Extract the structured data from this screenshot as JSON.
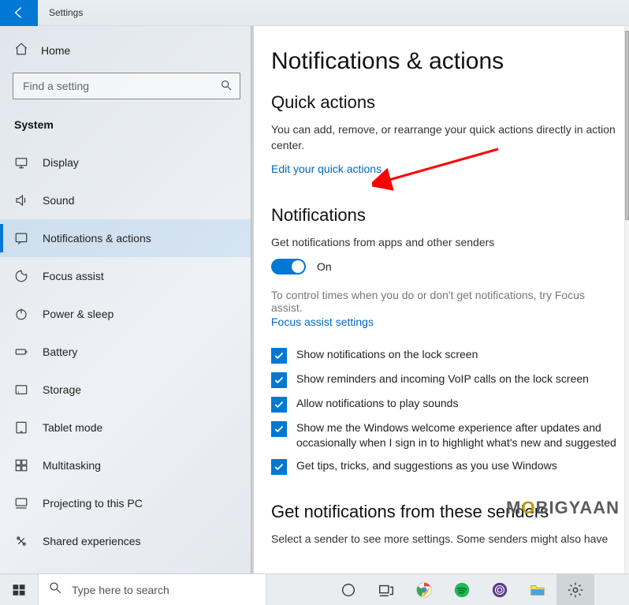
{
  "titlebar": {
    "title": "Settings"
  },
  "sidebar": {
    "home_label": "Home",
    "search_placeholder": "Find a setting",
    "section_head": "System",
    "items": [
      {
        "label": "Display"
      },
      {
        "label": "Sound"
      },
      {
        "label": "Notifications & actions"
      },
      {
        "label": "Focus assist"
      },
      {
        "label": "Power & sleep"
      },
      {
        "label": "Battery"
      },
      {
        "label": "Storage"
      },
      {
        "label": "Tablet mode"
      },
      {
        "label": "Multitasking"
      },
      {
        "label": "Projecting to this PC"
      },
      {
        "label": "Shared experiences"
      }
    ],
    "active_index": 2
  },
  "content": {
    "page_title": "Notifications & actions",
    "quick_actions": {
      "heading": "Quick actions",
      "description": "You can add, remove, or rearrange your quick actions directly in action center.",
      "link": "Edit your quick actions"
    },
    "notifications": {
      "heading": "Notifications",
      "master_label": "Get notifications from apps and other senders",
      "master_state_text": "On",
      "focus_hint": "To control times when you do or don't get notifications, try Focus assist.",
      "focus_link": "Focus assist settings",
      "checkboxes": [
        "Show notifications on the lock screen",
        "Show reminders and incoming VoIP calls on the lock screen",
        "Allow notifications to play sounds",
        "Show me the Windows welcome experience after updates and occasionally when I sign in to highlight what's new and suggested",
        "Get tips, tricks, and suggestions as you use Windows"
      ]
    },
    "senders": {
      "heading": "Get notifications from these senders",
      "description": "Select a sender to see more settings. Some senders might also have"
    }
  },
  "watermark": {
    "part1": "M",
    "o": "O",
    "part2": "BIGYAAN"
  },
  "taskbar": {
    "search_text": "Type here to search"
  }
}
